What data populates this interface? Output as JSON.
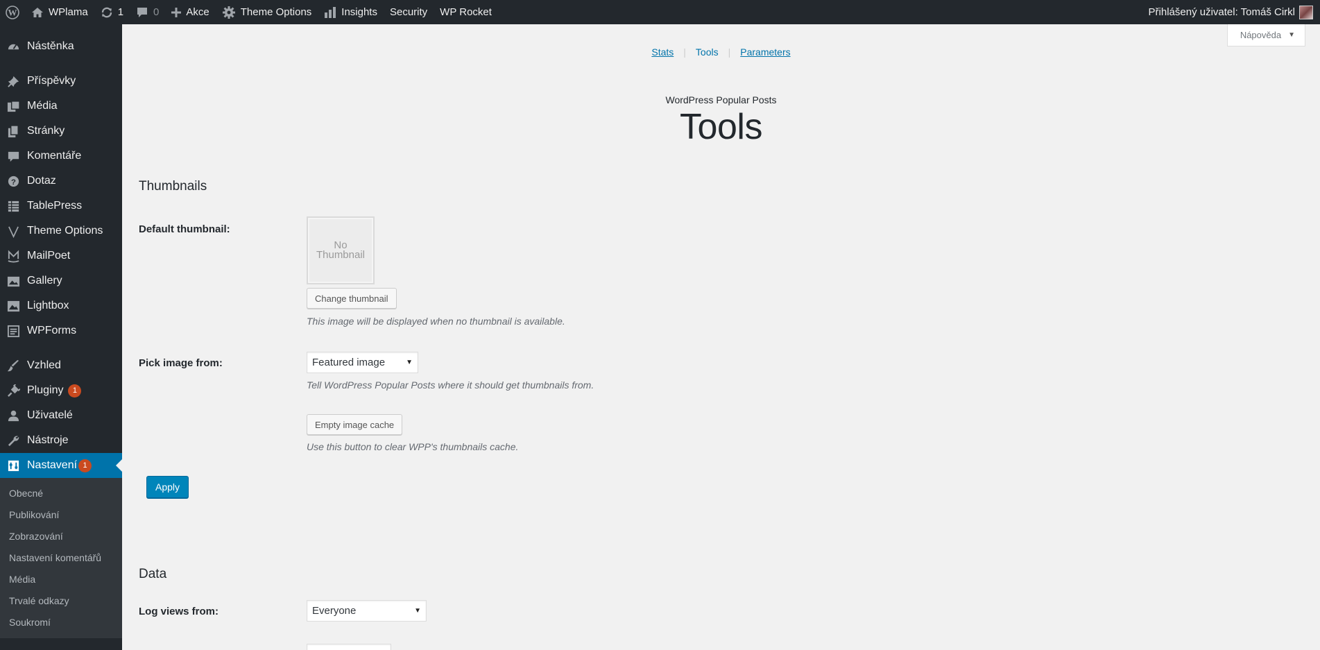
{
  "adminbar": {
    "site_name": "WPlama",
    "updates_count": "1",
    "comments_count": "0",
    "new_label": "Akce",
    "theme_options_label": "Theme Options",
    "insights_label": "Insights",
    "security_label": "Security",
    "wp_rocket_label": "WP Rocket",
    "user_greeting": "Přihlášený uživatel: Tomáš Cirkl"
  },
  "sidebar": {
    "items": [
      {
        "label": "Nástěnka",
        "icon": "dashboard-icon"
      },
      {
        "label": "Příspěvky",
        "icon": "pin-icon"
      },
      {
        "label": "Média",
        "icon": "media-icon"
      },
      {
        "label": "Stránky",
        "icon": "pages-icon"
      },
      {
        "label": "Komentáře",
        "icon": "comments-icon"
      },
      {
        "label": "Dotaz",
        "icon": "question-icon"
      },
      {
        "label": "TablePress",
        "icon": "table-icon"
      },
      {
        "label": "Theme Options",
        "icon": "v-icon"
      },
      {
        "label": "MailPoet",
        "icon": "mailpoet-icon"
      },
      {
        "label": "Gallery",
        "icon": "gallery-icon"
      },
      {
        "label": "Lightbox",
        "icon": "lightbox-icon"
      },
      {
        "label": "WPForms",
        "icon": "forms-icon"
      },
      {
        "label": "Vzhled",
        "icon": "brush-icon"
      },
      {
        "label": "Pluginy",
        "icon": "plugin-icon",
        "badge": "1"
      },
      {
        "label": "Uživatelé",
        "icon": "user-icon"
      },
      {
        "label": "Nástroje",
        "icon": "wrench-icon"
      },
      {
        "label": "Nastavení",
        "icon": "settings-icon",
        "badge": "1"
      }
    ],
    "submenu": [
      "Obecné",
      "Publikování",
      "Zobrazování",
      "Nastavení komentářů",
      "Média",
      "Trvalé odkazy",
      "Soukromí"
    ]
  },
  "help_tab_label": "Nápověda",
  "subnav": {
    "stats": "Stats",
    "tools": "Tools",
    "parameters": "Parameters"
  },
  "header": {
    "plugin_name": "WordPress Popular Posts",
    "title": "Tools"
  },
  "thumbnails": {
    "title": "Thumbnails",
    "default_thumbnail_label": "Default thumbnail:",
    "no_thumbnail_line1": "No",
    "no_thumbnail_line2": "Thumbnail",
    "change_button": "Change thumbnail",
    "default_desc": "This image will be displayed when no thumbnail is available.",
    "pick_label": "Pick image from:",
    "pick_value": "Featured image",
    "pick_desc": "Tell WordPress Popular Posts where it should get thumbnails from.",
    "empty_cache_button": "Empty image cache",
    "empty_cache_desc": "Use this button to clear WPP's thumbnails cache.",
    "apply_button": "Apply"
  },
  "data_section": {
    "title": "Data",
    "log_views_label": "Log views from:",
    "log_views_value": "Everyone"
  }
}
